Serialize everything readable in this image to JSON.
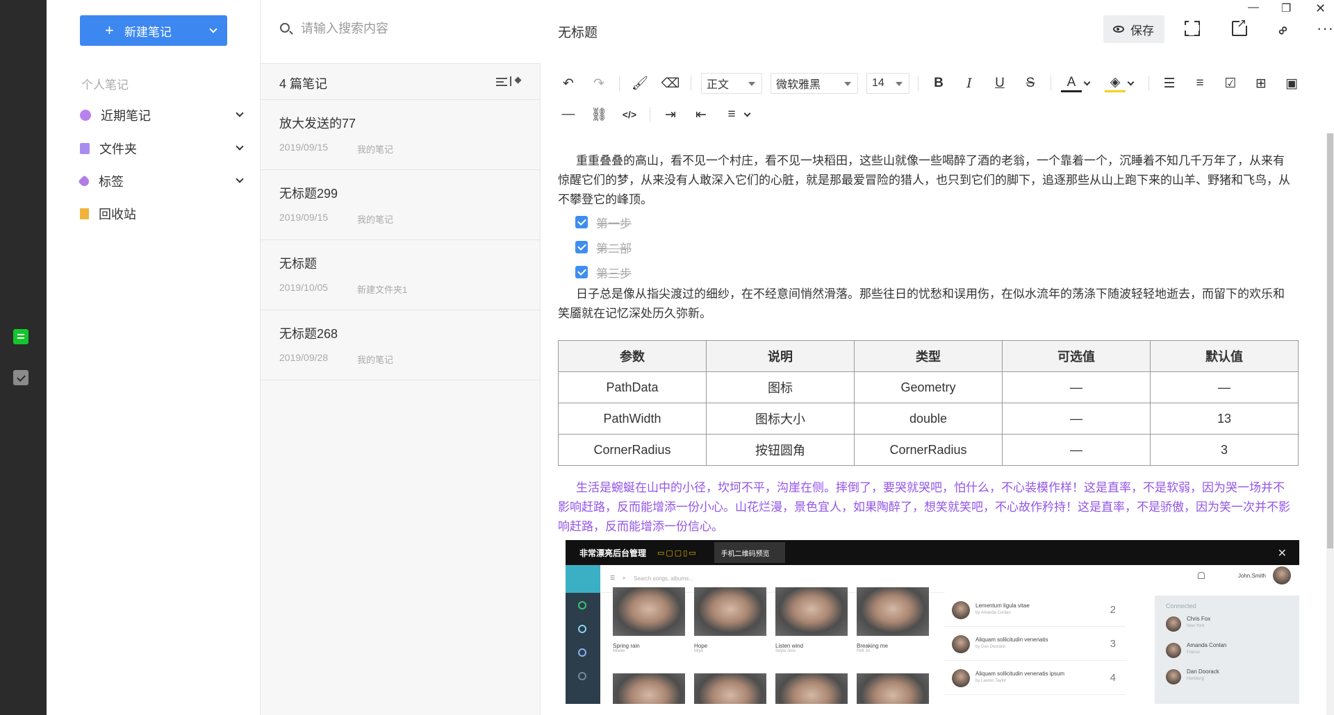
{
  "nav": {
    "new_note_label": "新建笔记",
    "section_title": "个人笔记",
    "items": [
      {
        "label": "近期笔记",
        "icon": "clock-icon"
      },
      {
        "label": "文件夹",
        "icon": "folder-icon"
      },
      {
        "label": "标签",
        "icon": "tag-icon"
      },
      {
        "label": "回收站",
        "icon": "trash-icon"
      }
    ]
  },
  "list": {
    "search_placeholder": "请输入搜索内容",
    "count_label": "4 篇笔记",
    "notes": [
      {
        "title": "放大发送的77",
        "date": "2019/09/15",
        "folder": "我的笔记"
      },
      {
        "title": "无标题299",
        "date": "2019/09/15",
        "folder": "我的笔记"
      },
      {
        "title": "无标题",
        "date": "2019/10/05",
        "folder": "新建文件夹1"
      },
      {
        "title": "无标题268",
        "date": "2019/09/28",
        "folder": "我的笔记"
      }
    ]
  },
  "editor": {
    "title": "无标题",
    "save_label": "保存",
    "toolbar": {
      "style_value": "正文",
      "font_value": "微软雅黑",
      "size_value": "14"
    },
    "para1": "重重叠叠的高山，看不见一个村庄，看不见一块稻田，这些山就像一些喝醉了酒的老翁，一个靠着一个，沉睡着不知几千万年了，从来有惊醒它们的梦，从来没有人敢深入它们的心脏，就是那最爱冒险的猎人，也只到它们的脚下，追逐那些从山上跑下来的山羊、野猪和飞鸟，从不攀登它的峰顶。",
    "tasks": [
      "第一步",
      "第二部",
      "第三步"
    ],
    "para2": "日子总是像从指尖渡过的细纱，在不经意间悄然滑落。那些往日的忧愁和误用伤，在似水流年的荡涤下随波轻轻地逝去，而留下的欢乐和笑靥就在记忆深处历久弥新。",
    "table": {
      "headers": [
        "参数",
        "说明",
        "类型",
        "可选值",
        "默认值"
      ],
      "rows": [
        [
          "PathData",
          "图标",
          "Geometry",
          "—",
          "—"
        ],
        [
          "PathWidth",
          "图标大小",
          "double",
          "—",
          "13"
        ],
        [
          "CornerRadius",
          "按钮圆角",
          "CornerRadius",
          "—",
          "3"
        ]
      ]
    },
    "para3": "生活是蜿蜒在山中的小径，坎坷不平，沟崖在侧。摔倒了，要哭就哭吧，怕什么，不心装模作样！这是直率，不是软弱，因为哭一场并不影响赶路，反而能增添一份小心。山花烂漫，景色宜人，如果陶醉了，想笑就笑吧，不心故作矜持！这是直率，不是骄傲，因为笑一次并不影响赶路，反而能增添一份信心。",
    "colors": {
      "accent": "#3c87f0",
      "purple_text": "#9355e8",
      "checkbox": "#3e8ef0"
    }
  },
  "screenshot": {
    "app_title": "非常漂亮后台管理",
    "tab_label": "手机二维码预览",
    "search_placeholder": "Search songs, albums...",
    "user": "John.Smith",
    "cards": [
      {
        "name": "Spring rain",
        "artist": "Miaow"
      },
      {
        "name": "Hope",
        "artist": "Miya"
      },
      {
        "name": "Listen wind",
        "artist": "Soyla Jess"
      },
      {
        "name": "Breaking me",
        "artist": "Pett JA"
      }
    ],
    "rows": [
      {
        "title": "Lementum ligula vitae",
        "by": "by Amanda Conlan",
        "num": "2"
      },
      {
        "title": "Aliquam sollicitudin venenatis",
        "by": "by Dan Doorack",
        "num": "3"
      },
      {
        "title": "Aliquam sollicitudin venenatis ipsum",
        "by": "by Lauren Taylor",
        "num": "4"
      }
    ],
    "connected_label": "Connected",
    "contacts": [
      {
        "name": "Chris Fox",
        "place": "New York"
      },
      {
        "name": "Amanda Conlan",
        "place": "France"
      },
      {
        "name": "Dan Doorack",
        "place": "Hamburg"
      }
    ]
  }
}
